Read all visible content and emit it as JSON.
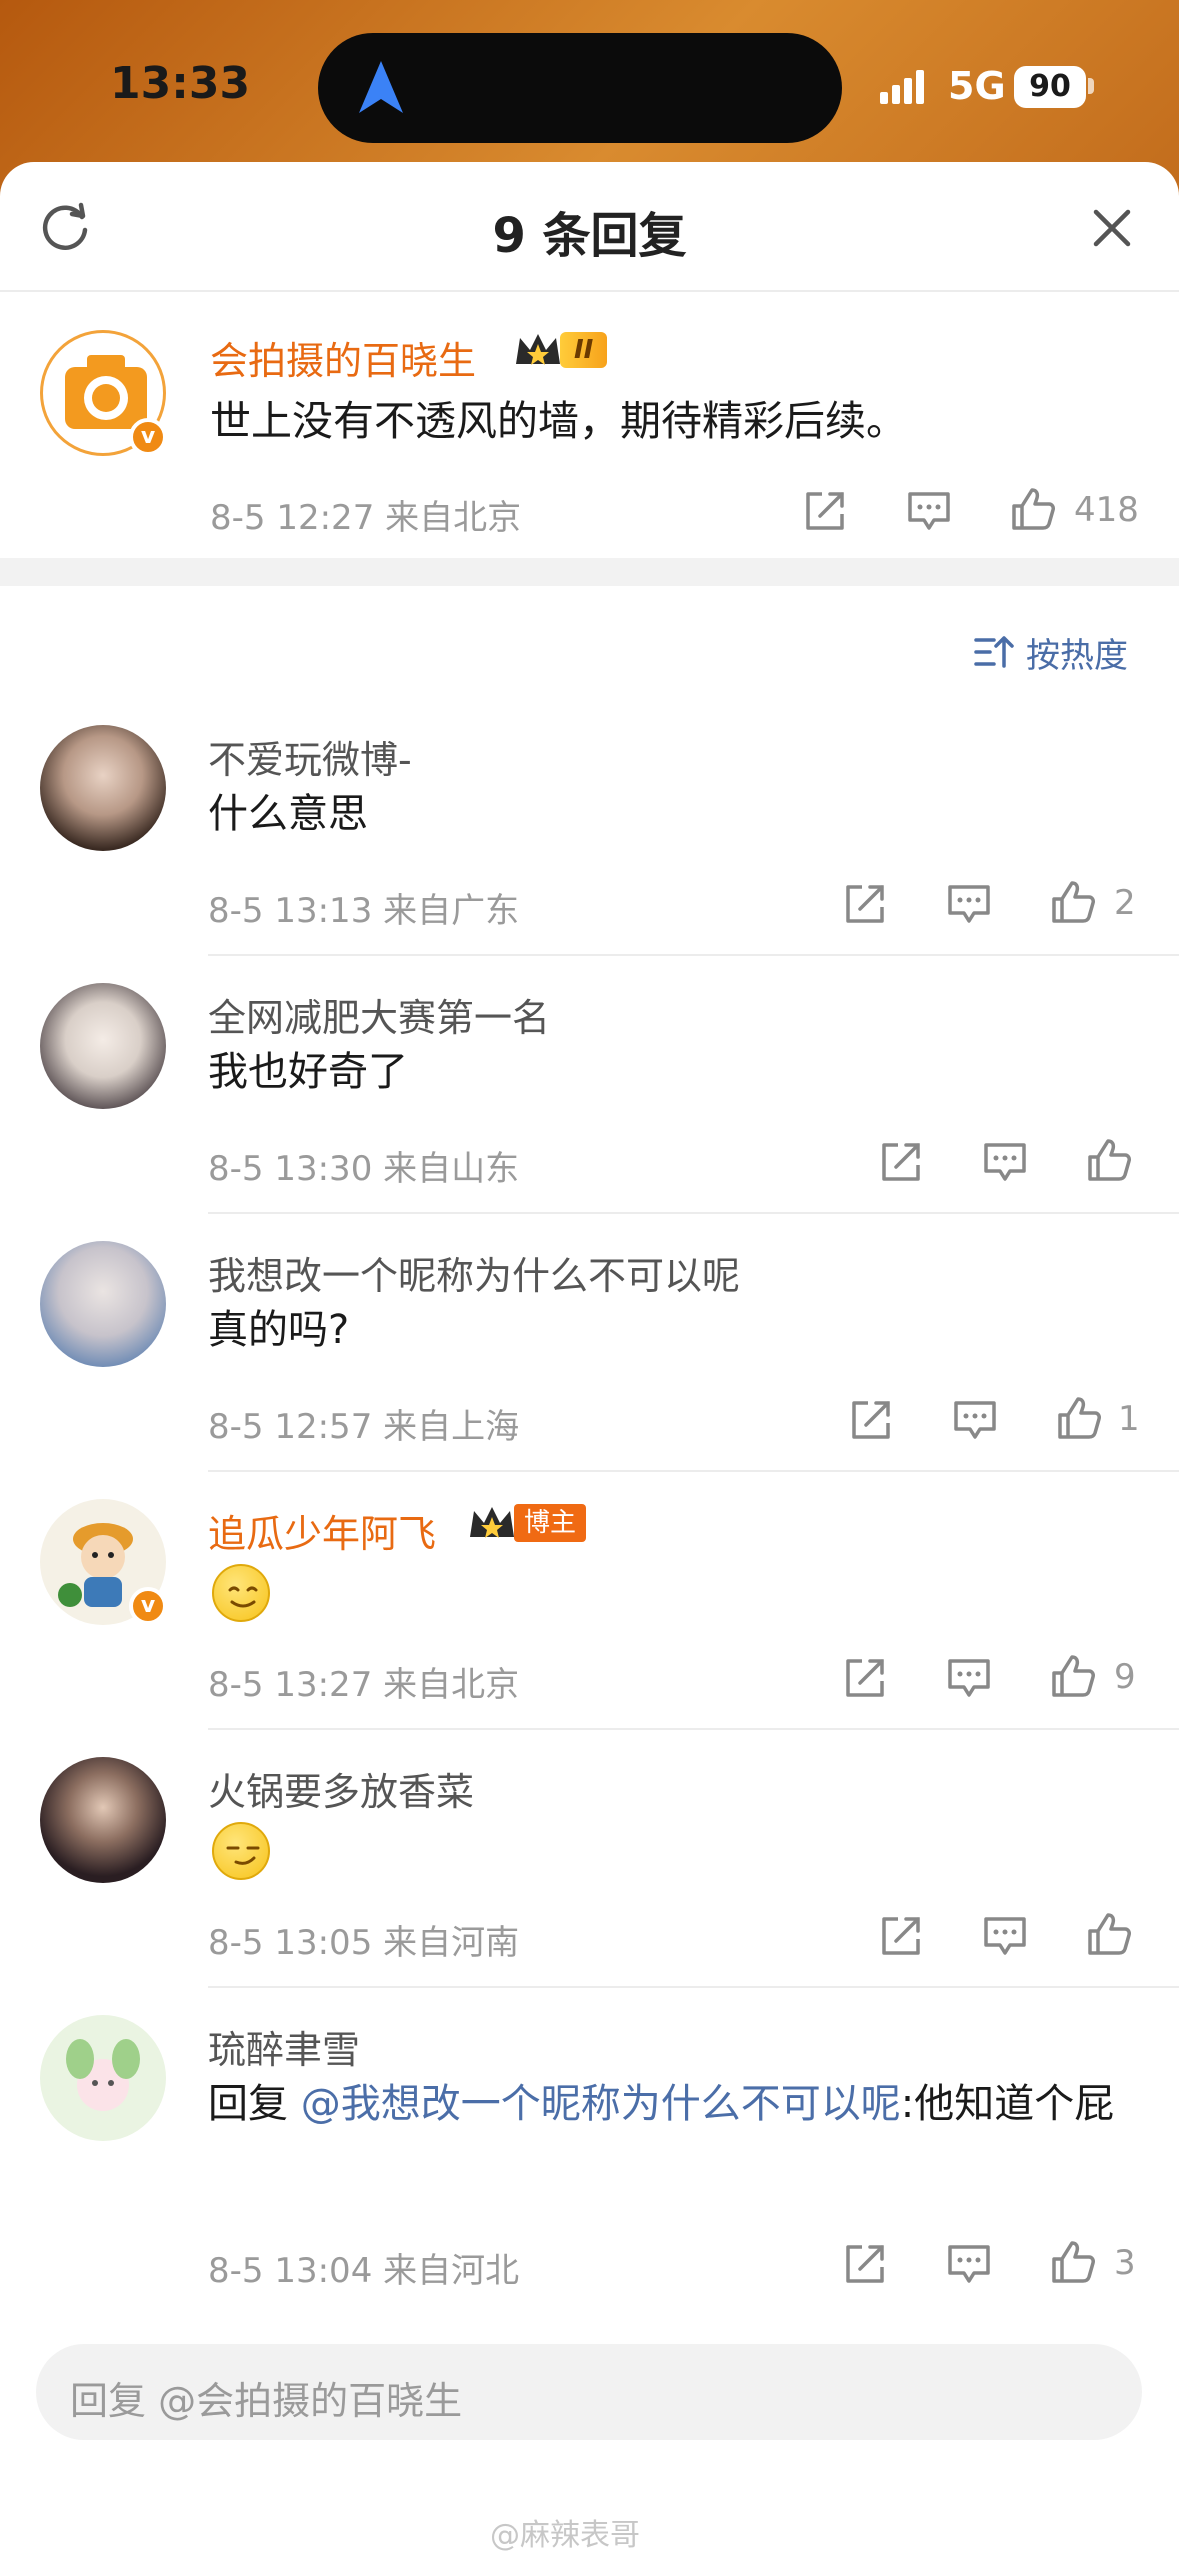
{
  "status_bar": {
    "time": "13:33",
    "network": "5G",
    "battery": "90"
  },
  "header": {
    "title": "9 条回复"
  },
  "root_comment": {
    "user": "会拍摄的百晓生",
    "level_badge": "II",
    "text": "世上没有不透风的墙，期待精彩后续。",
    "meta": "8-5 12:27  来自北京",
    "likes": "418"
  },
  "sort": {
    "label": "按热度"
  },
  "replies": [
    {
      "user": "不爱玩微博-",
      "text": "什么意思",
      "meta": "8-5 13:13  来自广东",
      "likes": "2"
    },
    {
      "user": "全网减肥大赛第一名",
      "text": "我也好奇了",
      "meta": "8-5 13:30  来自山东",
      "likes": ""
    },
    {
      "user": "我想改一个昵称为什么不可以呢",
      "text": "真的吗?",
      "meta": "8-5 12:57  来自上海",
      "likes": "1"
    },
    {
      "user": "追瓜少年阿飞",
      "badge": "博主",
      "text": "",
      "emoji": "smile-emoji",
      "meta": "8-5 13:27  来自北京",
      "likes": "9"
    },
    {
      "user": "火锅要多放香菜",
      "text": "",
      "emoji": "smirk-emoji",
      "meta": "8-5 13:05  来自河南",
      "likes": ""
    },
    {
      "user": "琉醉聿雪",
      "text_prefix": "回复",
      "mention": "@我想改一个昵称为什么不可以呢",
      "text_suffix": ":他知道个屁",
      "meta": "8-5 13:04  来自河北",
      "likes": "3"
    }
  ],
  "reply_bar": {
    "placeholder": "回复 @会拍摄的百晓生"
  },
  "watermark": "@麻辣表哥",
  "colors": {
    "accent_orange": "#e86a12",
    "link_blue": "#4b6ea8",
    "meta_gray": "#9a9a9a"
  }
}
